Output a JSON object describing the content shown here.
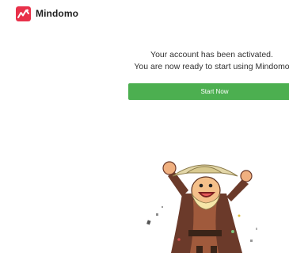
{
  "brand": {
    "name": "Mindomo",
    "logo_icon": "mindomo-logo-icon",
    "logo_color": "#e8314a"
  },
  "message": {
    "line1": "Your account has been activated.",
    "line2": "You are now ready to start using Mindomo"
  },
  "actions": {
    "start_label": "Start Now",
    "start_color": "#4caf50"
  },
  "illustration": {
    "icon": "celebrating-character-illustration"
  }
}
